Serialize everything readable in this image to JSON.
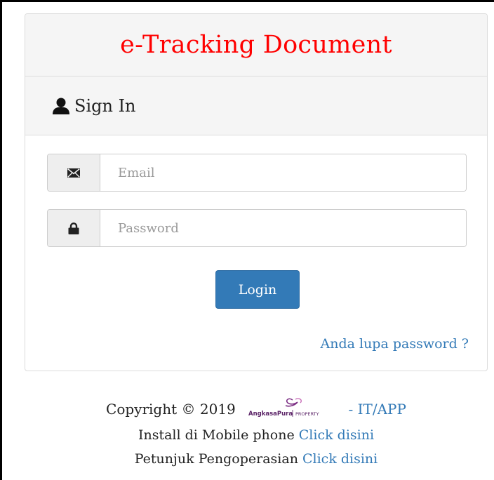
{
  "header": {
    "title": "e-Tracking Document"
  },
  "signin": {
    "heading": "Sign In",
    "icon": "user-icon"
  },
  "form": {
    "email": {
      "icon": "envelope-icon",
      "placeholder": "Email",
      "value": ""
    },
    "password": {
      "icon": "lock-icon",
      "placeholder": "Password",
      "value": ""
    },
    "login_label": "Login",
    "forgot_label": "Anda lupa password ?"
  },
  "footer": {
    "copyright": "Copyright © 2019",
    "logo_text": "AngkasaPura | PROPERTY",
    "dept": "- IT/APP",
    "install_text": "Install di Mobile phone",
    "install_link": "Click disini",
    "guide_text": "Petunjuk Pengoperasian",
    "guide_link": "Click disini"
  },
  "colors": {
    "title": "#ff0000",
    "primary": "#337ab7",
    "panel_header_bg": "#f5f5f5",
    "logo_purple": "#7b2d83"
  }
}
